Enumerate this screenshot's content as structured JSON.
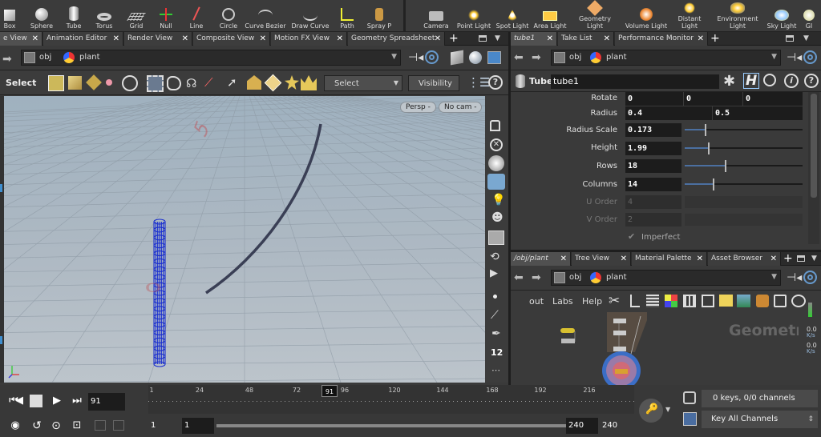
{
  "shelf": {
    "left_tools": [
      {
        "id": "box",
        "label": "Box"
      },
      {
        "id": "sphere",
        "label": "Sphere"
      },
      {
        "id": "tube",
        "label": "Tube"
      },
      {
        "id": "torus",
        "label": "Torus"
      },
      {
        "id": "grid",
        "label": "Grid"
      },
      {
        "id": "null",
        "label": "Null"
      },
      {
        "id": "line",
        "label": "Line"
      },
      {
        "id": "circle",
        "label": "Circle"
      },
      {
        "id": "curve-bezier",
        "label": "Curve Bezier"
      },
      {
        "id": "draw-curve",
        "label": "Draw Curve"
      },
      {
        "id": "path",
        "label": "Path"
      },
      {
        "id": "spray-paint",
        "label": "Spray P"
      }
    ],
    "right_tools": [
      {
        "id": "camera",
        "label": "Camera"
      },
      {
        "id": "point-light",
        "label": "Point Light"
      },
      {
        "id": "spot-light",
        "label": "Spot Light"
      },
      {
        "id": "area-light",
        "label": "Area Light"
      },
      {
        "id": "geometry-light",
        "label": "Geometry\nLight"
      },
      {
        "id": "volume-light",
        "label": "Volume Light"
      },
      {
        "id": "distant-light",
        "label": "Distant\nLight"
      },
      {
        "id": "environment-light",
        "label": "Environment\nLight"
      },
      {
        "id": "sky-light",
        "label": "Sky Light"
      },
      {
        "id": "gi-light",
        "label": "GI"
      }
    ]
  },
  "left_tabs": [
    {
      "label": "e View",
      "active": true
    },
    {
      "label": "Animation Editor"
    },
    {
      "label": "Render View"
    },
    {
      "label": "Composite View"
    },
    {
      "label": "Motion FX View"
    },
    {
      "label": "Geometry Spreadsheet"
    }
  ],
  "left_path": {
    "obj": "obj",
    "node": "plant"
  },
  "viewer_toolbar": {
    "select_label": "Select",
    "select_dropdown": "Select",
    "visibility_label": "Visibility"
  },
  "viewport": {
    "persp_label": "Persp -",
    "cam_label": "No cam -",
    "grid_numbers": [
      "5",
      "0"
    ],
    "side_number": "12"
  },
  "param_tabs": [
    {
      "label": "tube1",
      "active": true
    },
    {
      "label": "Take List"
    },
    {
      "label": "Performance Monitor"
    }
  ],
  "param_path": {
    "obj": "obj",
    "node": "plant"
  },
  "node_header": {
    "type": "Tube",
    "name": "tube1"
  },
  "params": {
    "rotate": {
      "label": "Rotate",
      "values": [
        "0",
        "0",
        "0"
      ]
    },
    "radius": {
      "label": "Radius",
      "values": [
        "0.4",
        "0.5"
      ]
    },
    "radius_scale": {
      "label": "Radius Scale",
      "value": "0.173",
      "slider": 0.17
    },
    "height": {
      "label": "Height",
      "value": "1.99",
      "slider": 0.2
    },
    "rows": {
      "label": "Rows",
      "value": "18",
      "slider": 0.34
    },
    "columns": {
      "label": "Columns",
      "value": "14",
      "slider": 0.24
    },
    "u_order": {
      "label": "U Order",
      "value": "4"
    },
    "v_order": {
      "label": "V Order",
      "value": "2"
    },
    "imperfect": {
      "label": "Imperfect",
      "checked": true
    }
  },
  "network_tabs": [
    {
      "label": "/obj/plant",
      "active": true
    },
    {
      "label": "Tree View"
    },
    {
      "label": "Material Palette"
    },
    {
      "label": "Asset Browser"
    }
  ],
  "network_path": {
    "obj": "obj",
    "node": "plant"
  },
  "network_menu": [
    "out",
    "Labs",
    "Help"
  ],
  "network": {
    "watermark": "Geometr",
    "rate1": "0.0",
    "rate1_unit": "K/s",
    "rate2": "0.0",
    "rate2_unit": "K/s"
  },
  "timeline": {
    "current_frame": "91",
    "ruler_ticks": [
      "1",
      "24",
      "48",
      "72",
      "96",
      "120",
      "144",
      "168",
      "192",
      "216"
    ],
    "marker": "91",
    "range_start": "1",
    "range_start2": "1",
    "range_end": "240",
    "range_end2": "240"
  },
  "keys": {
    "status": "0 keys, 0/0 channels",
    "key_all": "Key All Channels"
  },
  "colors": {
    "viewport_top": "#9fb1bf",
    "tube_wire": "#1a2fcf",
    "curve": "#3a3f55",
    "accent_blue": "#4b6fa0"
  }
}
